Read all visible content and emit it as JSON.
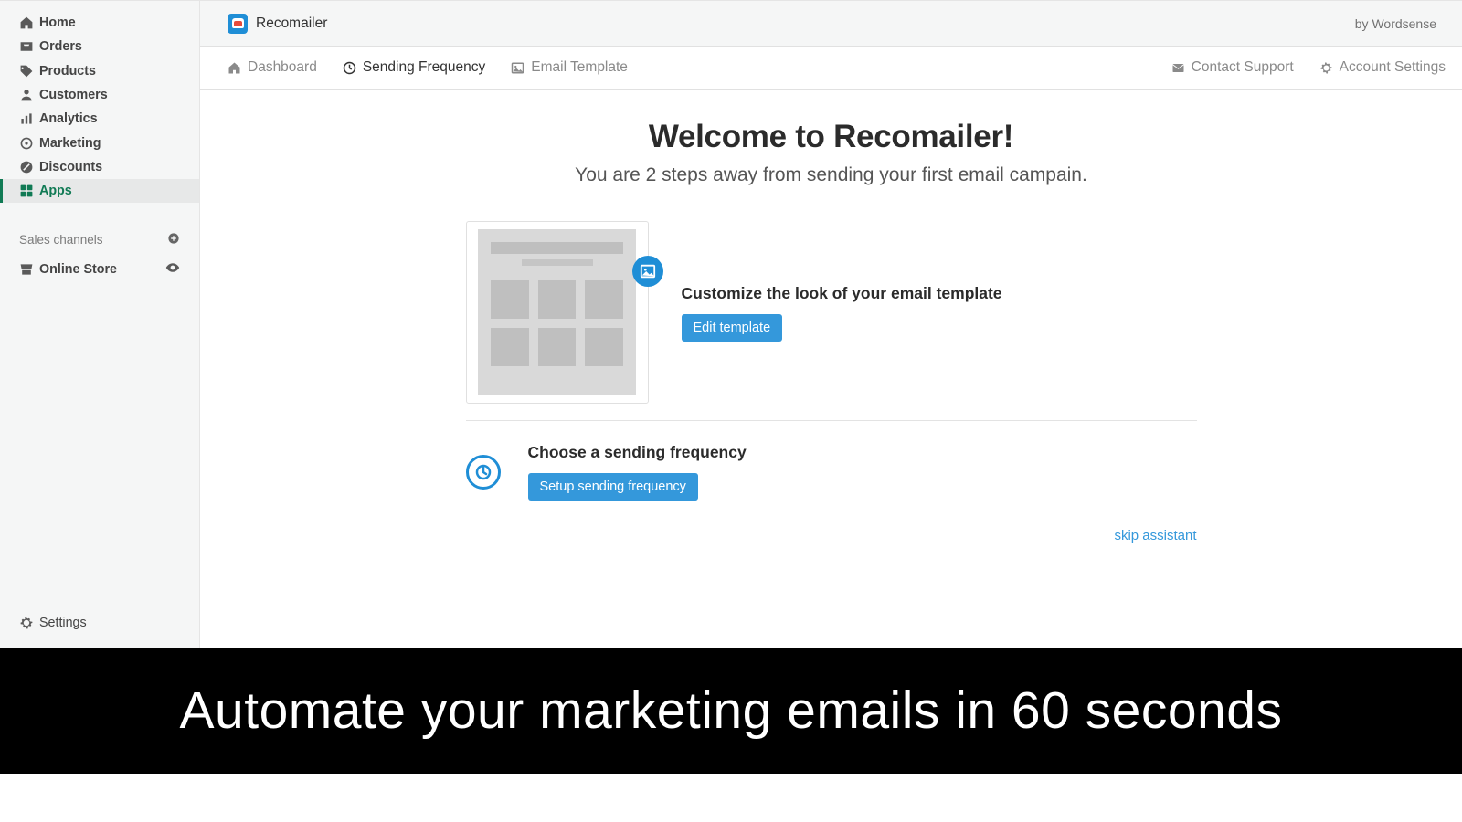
{
  "sidebar": {
    "items": [
      {
        "label": "Home"
      },
      {
        "label": "Orders"
      },
      {
        "label": "Products"
      },
      {
        "label": "Customers"
      },
      {
        "label": "Analytics"
      },
      {
        "label": "Marketing"
      },
      {
        "label": "Discounts"
      },
      {
        "label": "Apps"
      }
    ],
    "channels_header": "Sales channels",
    "channels": [
      {
        "label": "Online Store"
      }
    ],
    "bottom": {
      "settings_label": "Settings"
    }
  },
  "header": {
    "app_name": "Recomailer",
    "by": "by Wordsense"
  },
  "tabs": {
    "dashboard": "Dashboard",
    "sending_frequency": "Sending Frequency",
    "email_template": "Email Template",
    "contact_support": "Contact Support",
    "account_settings": "Account Settings"
  },
  "welcome": {
    "title": "Welcome to Recomailer!",
    "subtitle": "You are 2 steps away from sending your first email campain."
  },
  "steps": {
    "customize": {
      "title": "Customize the look of your email template",
      "button": "Edit template"
    },
    "frequency": {
      "title": "Choose a sending frequency",
      "button": "Setup sending frequency"
    },
    "skip": "skip assistant"
  },
  "footer": {
    "caption": "Automate your marketing emails in 60 seconds"
  }
}
